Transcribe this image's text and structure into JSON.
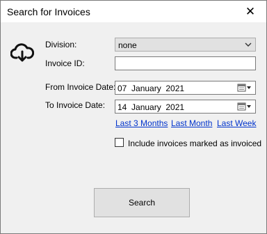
{
  "window": {
    "title": "Search for Invoices",
    "close_glyph": "✕"
  },
  "form": {
    "division_label": "Division:",
    "division_value": "none",
    "invoice_id_label": "Invoice ID:",
    "invoice_id_value": "",
    "from_date_label": "From Invoice Date:",
    "from_date_value": "07  January  2021",
    "to_date_label": "To Invoice Date:",
    "to_date_value": "14  January  2021"
  },
  "quick_links": {
    "last_3_months": "Last 3 Months",
    "last_month": "Last Month",
    "last_week": "Last Week"
  },
  "include_invoiced": {
    "label": "Include invoices marked as invoiced",
    "checked": false
  },
  "search_button": "Search",
  "icons": {
    "cloud": "cloud-download-icon",
    "dropdown": "chevron-down-icon",
    "calendar": "calendar-dropdown-icon"
  }
}
